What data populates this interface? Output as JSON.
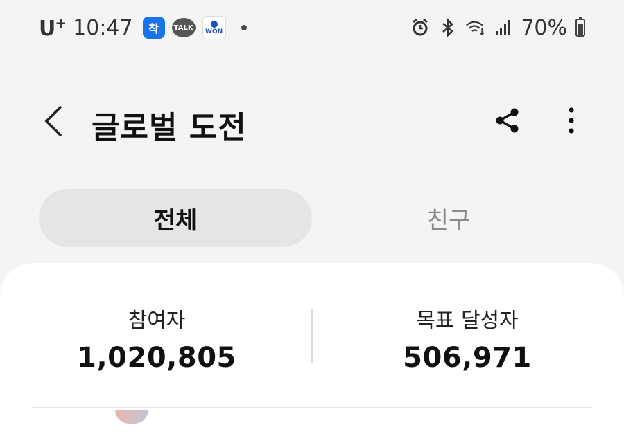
{
  "status_bar": {
    "carrier": "U",
    "carrier_plus": "+",
    "time": "10:47",
    "notifications": [
      {
        "icon": "chak-app-icon",
        "label": "착"
      },
      {
        "icon": "kakaotalk-icon",
        "label": "TALK"
      },
      {
        "icon": "won-banking-icon",
        "label": "WON"
      }
    ],
    "battery_percent": "70%",
    "battery_level": 0.7,
    "icons": [
      "alarm-icon",
      "bluetooth-icon",
      "wifi-icon",
      "signal-icon",
      "battery-icon"
    ]
  },
  "header": {
    "title": "글로벌 도전",
    "back_icon": "chevron-left-icon",
    "share_icon": "share-icon",
    "menu_icon": "more-vertical-icon"
  },
  "tabs": [
    {
      "label": "전체",
      "selected": true
    },
    {
      "label": "친구",
      "selected": false
    }
  ],
  "stats": {
    "participants_label": "참여자",
    "participants_value": "1,020,805",
    "achievers_label": "목표 달성자",
    "achievers_value": "506,971"
  },
  "colors": {
    "background": "#f4f4f4",
    "card": "#ffffff",
    "selected_tab": "#e5e5e5",
    "unselected_text": "#8a8a8a"
  }
}
